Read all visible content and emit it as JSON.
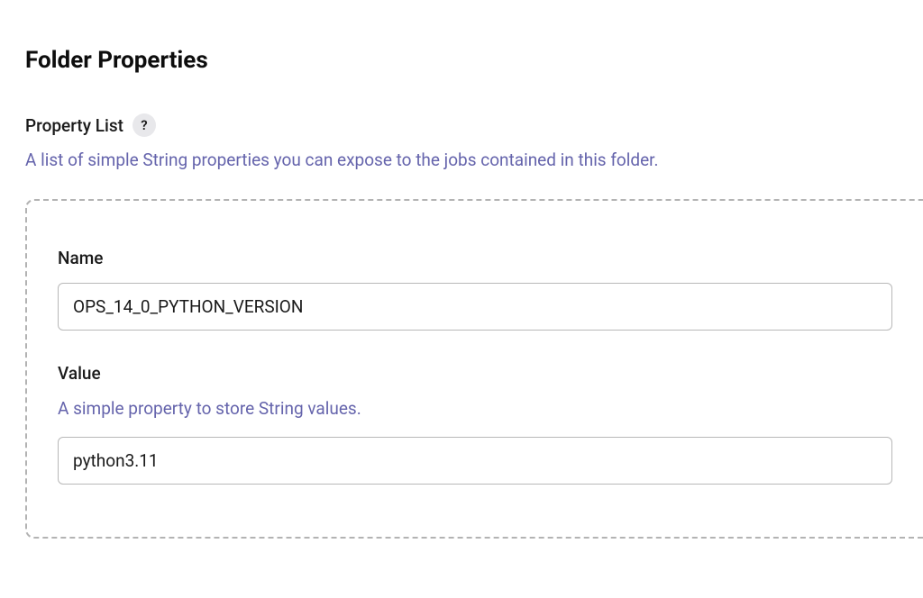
{
  "page": {
    "title": "Folder Properties"
  },
  "propertyList": {
    "label": "Property List",
    "helpGlyph": "?",
    "description": "A list of simple String properties you can expose to the jobs contained in this folder."
  },
  "property": {
    "nameLabel": "Name",
    "nameValue": "OPS_14_0_PYTHON_VERSION",
    "valueLabel": "Value",
    "valueDescription": "A simple property to store String values.",
    "valueValue": "python3.11"
  }
}
